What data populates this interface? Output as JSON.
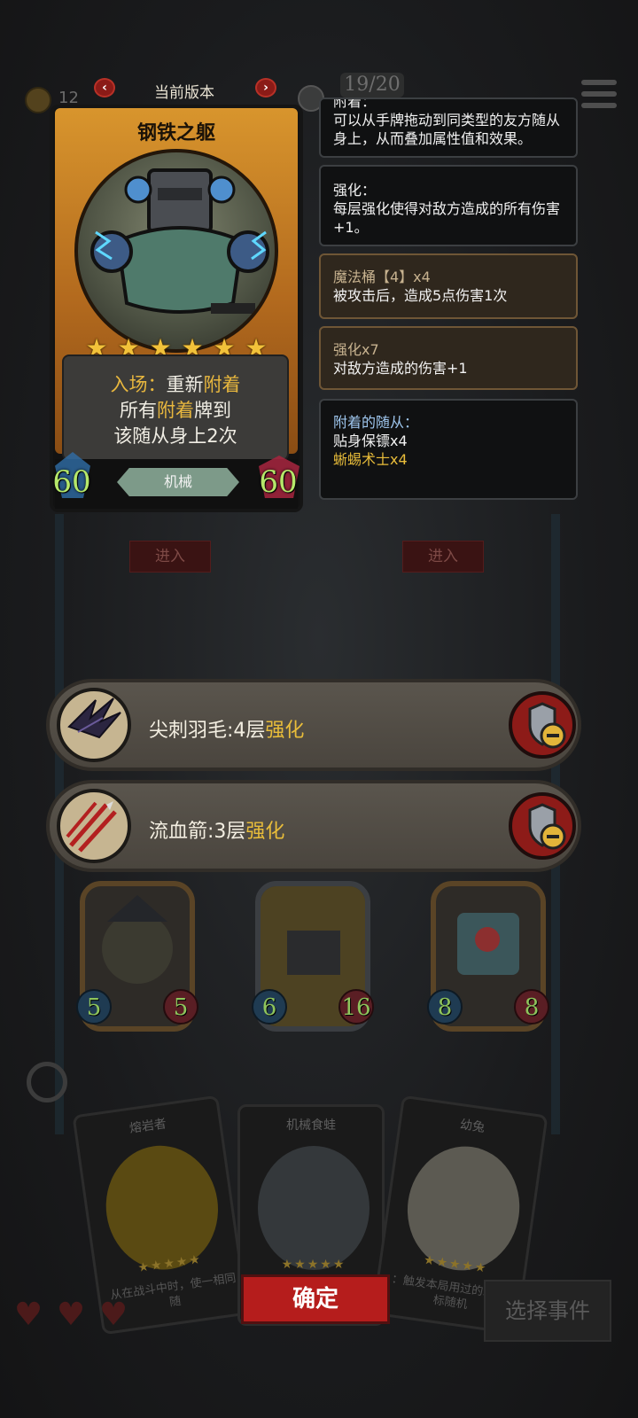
{
  "colors": {
    "accent_gold": "#e9bd3a",
    "stat_green": "#b6e86a",
    "confirm_red": "#b51d1c",
    "tribe_green": "#7d9a89"
  },
  "hud": {
    "coin_count": "12",
    "progress": "19/20"
  },
  "version_selector": {
    "label": "当前版本",
    "prev_icon": "chevron-left-icon",
    "next_icon": "chevron-right-icon"
  },
  "card": {
    "name": "钢铁之躯",
    "stars": 6,
    "text_line1_prefix": "入场：",
    "text_line1_a": "重新",
    "text_line1_b": "附着",
    "text_line2_a": "所有",
    "text_line2_b": "附着",
    "text_line2_c": "牌到",
    "text_line3": "该随从身上2次",
    "attack": "60",
    "health": "60",
    "tribe": "机械"
  },
  "panels": [
    {
      "title": "附着：",
      "body": "可以从手牌拖动到同类型的友方随从身上，从而叠加属性值和效果。",
      "style": "dark"
    },
    {
      "title": "强化：",
      "body": "每层强化使得对敌方造成的所有伤害+1。",
      "style": "dark"
    },
    {
      "title": "魔法桶【4】x4",
      "body": "被攻击后，造成5点伤害1次",
      "style": "brown"
    },
    {
      "title": "强化x7",
      "body": "对敌方造成的伤害+1",
      "style": "brown"
    }
  ],
  "attached_panel": {
    "title": "附着的随从：",
    "item1": "贴身保镖x4",
    "item2": "蜥蜴术士x4"
  },
  "board": {
    "enter_label": "进入"
  },
  "buffs": [
    {
      "name": "尖刺羽毛:4层",
      "suffix": "强化",
      "icon": "spiked-feather-icon",
      "remove_icon": "shield-minus-icon"
    },
    {
      "name": "流血箭:3层",
      "suffix": "强化",
      "icon": "bleeding-arrows-icon",
      "remove_icon": "shield-minus-icon"
    }
  ],
  "minions": [
    {
      "attack": "5",
      "health": "5"
    },
    {
      "attack": "6",
      "health": "16"
    },
    {
      "attack": "8",
      "health": "8"
    }
  ],
  "hand": [
    {
      "title": "熔岩者",
      "text": "从在战斗中时，使一相同随"
    },
    {
      "title": "机械食蛙",
      "text": ""
    },
    {
      "title": "幼兔",
      "text": "：触发本局用过的3个目标随机"
    }
  ],
  "controls": {
    "confirm": "确定",
    "select_event": "选择事件"
  }
}
